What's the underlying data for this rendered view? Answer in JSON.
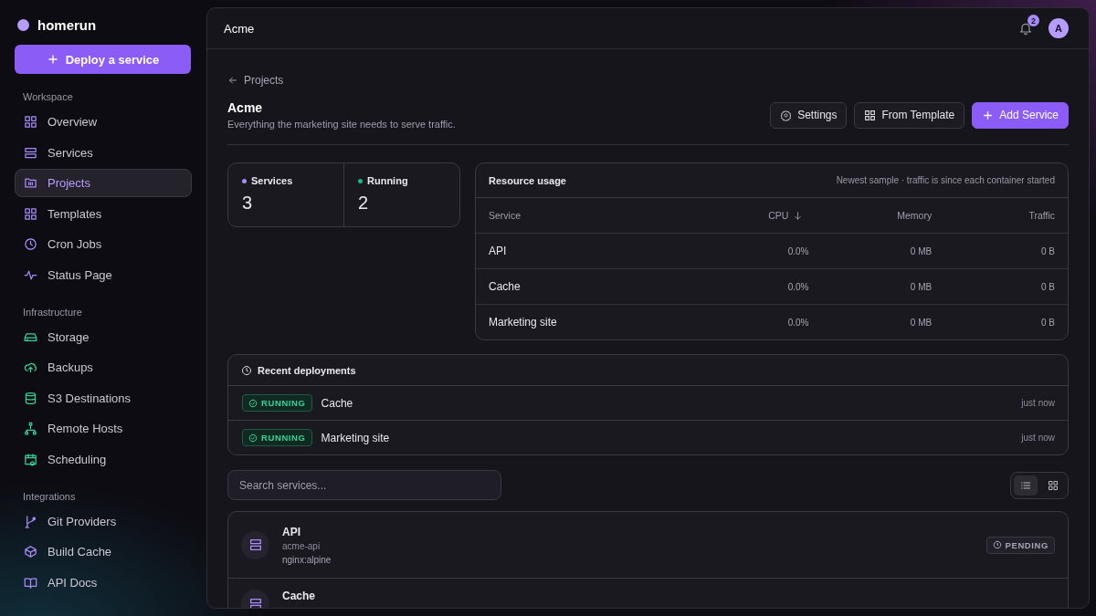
{
  "brand": {
    "name": "homerun"
  },
  "deploy_button": {
    "label": "Deploy a service"
  },
  "sidebar": {
    "sections": [
      {
        "title": "Workspace",
        "items": [
          {
            "label": "Overview",
            "selected": false
          },
          {
            "label": "Services",
            "selected": false
          },
          {
            "label": "Projects",
            "selected": true
          },
          {
            "label": "Templates",
            "selected": false
          },
          {
            "label": "Cron Jobs",
            "selected": false
          },
          {
            "label": "Status Page",
            "selected": false
          }
        ]
      },
      {
        "title": "Infrastructure",
        "items": [
          {
            "label": "Storage",
            "selected": false
          },
          {
            "label": "Backups",
            "selected": false
          },
          {
            "label": "S3 Destinations",
            "selected": false
          },
          {
            "label": "Remote Hosts",
            "selected": false
          },
          {
            "label": "Scheduling",
            "selected": false
          }
        ]
      },
      {
        "title": "Integrations",
        "items": [
          {
            "label": "Git Providers",
            "selected": false
          },
          {
            "label": "Build Cache",
            "selected": false
          },
          {
            "label": "API Docs",
            "selected": false
          }
        ]
      }
    ]
  },
  "topbar": {
    "title": "Acme",
    "notification_count": "2",
    "avatar": "A"
  },
  "back_link": "Projects",
  "project": {
    "title": "Acme",
    "description": "Everything the marketing site needs to serve traffic."
  },
  "actions": [
    {
      "label": "Settings",
      "kind": "settings"
    },
    {
      "label": "From Template",
      "kind": "template"
    },
    {
      "label": "Add Service",
      "kind": "add"
    }
  ],
  "stats": [
    {
      "label": "Services",
      "value": "3",
      "color": "#a78bfa"
    },
    {
      "label": "Running",
      "value": "2",
      "color": "#10b981"
    }
  ],
  "resource_usage": {
    "title": "Resource usage",
    "note": "Newest sample · traffic is since each container started",
    "columns": [
      {
        "label": "Service"
      },
      {
        "label": "CPU",
        "sorted": true
      },
      {
        "label": "Memory"
      },
      {
        "label": "Traffic"
      }
    ],
    "rows": [
      [
        "API",
        "0.0%",
        "0 MB",
        "0 B"
      ],
      [
        "Cache",
        "0.0%",
        "0 MB",
        "0 B"
      ],
      [
        "Marketing site",
        "0.0%",
        "0 MB",
        "0 B"
      ]
    ]
  },
  "recent_deployments": {
    "title": "Recent deployments",
    "items": [
      {
        "status": "RUNNING",
        "kind": "running",
        "name": "Cache",
        "time": "just now"
      },
      {
        "status": "RUNNING",
        "kind": "running",
        "name": "Marketing site",
        "time": "just now"
      }
    ]
  },
  "search": {
    "placeholder": "Search services..."
  },
  "view_toggle": [
    {
      "kind": "list",
      "selected": true
    },
    {
      "kind": "grid",
      "selected": false
    }
  ],
  "services": [
    {
      "name": "API",
      "slug": "acme-api",
      "image": "nginx:alpine",
      "status": "PENDING",
      "kind": "pending"
    },
    {
      "name": "Cache"
    }
  ]
}
